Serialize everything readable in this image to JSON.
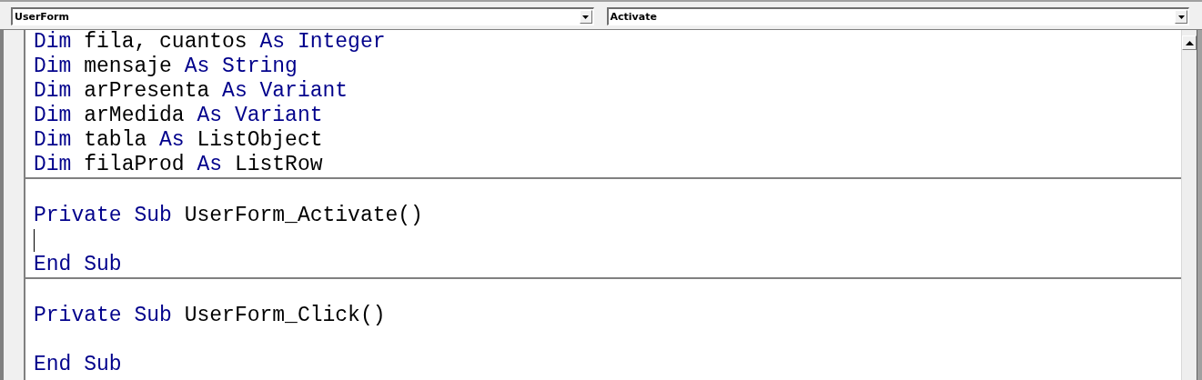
{
  "object_dropdown": {
    "value": "UserForm"
  },
  "procedure_dropdown": {
    "value": "Activate"
  },
  "procedures": [
    {
      "lines": [
        {
          "kind": "code",
          "tokens": [
            {
              "text": "Dim",
              "keyword": true
            },
            {
              "text": "fila, cuantos",
              "keyword": false
            },
            {
              "text": "As",
              "keyword": true
            },
            {
              "text": "Integer",
              "keyword": true
            }
          ]
        },
        {
          "kind": "code",
          "tokens": [
            {
              "text": "Dim",
              "keyword": true
            },
            {
              "text": "mensaje",
              "keyword": false
            },
            {
              "text": "As",
              "keyword": true
            },
            {
              "text": "String",
              "keyword": true
            }
          ]
        },
        {
          "kind": "code",
          "tokens": [
            {
              "text": "Dim",
              "keyword": true
            },
            {
              "text": "arPresenta",
              "keyword": false
            },
            {
              "text": "As",
              "keyword": true
            },
            {
              "text": "Variant",
              "keyword": true
            }
          ]
        },
        {
          "kind": "code",
          "tokens": [
            {
              "text": "Dim",
              "keyword": true
            },
            {
              "text": "arMedida",
              "keyword": false
            },
            {
              "text": "As",
              "keyword": true
            },
            {
              "text": "Variant",
              "keyword": true
            }
          ]
        },
        {
          "kind": "code",
          "tokens": [
            {
              "text": "Dim",
              "keyword": true
            },
            {
              "text": "tabla",
              "keyword": false
            },
            {
              "text": "As",
              "keyword": true
            },
            {
              "text": "ListObject",
              "keyword": false
            }
          ]
        },
        {
          "kind": "code",
          "tokens": [
            {
              "text": "Dim",
              "keyword": true
            },
            {
              "text": "filaProd",
              "keyword": false
            },
            {
              "text": "As",
              "keyword": true
            },
            {
              "text": "ListRow",
              "keyword": false
            }
          ]
        }
      ]
    },
    {
      "lines": [
        {
          "kind": "blank"
        },
        {
          "kind": "code",
          "tokens": [
            {
              "text": "Private",
              "keyword": true
            },
            {
              "text": "Sub",
              "keyword": true
            },
            {
              "text": "UserForm_Activate()",
              "keyword": false
            }
          ]
        },
        {
          "kind": "caret"
        },
        {
          "kind": "code",
          "tokens": [
            {
              "text": "End",
              "keyword": true
            },
            {
              "text": "Sub",
              "keyword": true
            }
          ]
        }
      ]
    },
    {
      "lines": [
        {
          "kind": "blank"
        },
        {
          "kind": "code",
          "tokens": [
            {
              "text": "Private",
              "keyword": true
            },
            {
              "text": "Sub",
              "keyword": true
            },
            {
              "text": "UserForm_Click()",
              "keyword": false
            }
          ]
        },
        {
          "kind": "blank"
        },
        {
          "kind": "code",
          "tokens": [
            {
              "text": "End",
              "keyword": true
            },
            {
              "text": "Sub",
              "keyword": true
            }
          ]
        }
      ]
    }
  ]
}
